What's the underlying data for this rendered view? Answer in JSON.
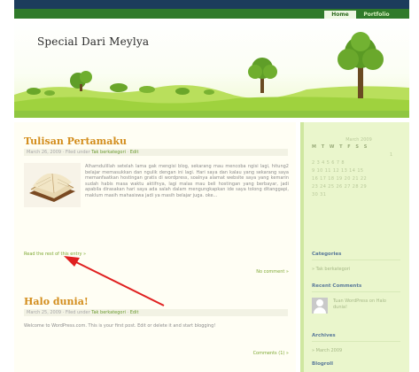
{
  "nav": {
    "items": [
      "Home",
      "Portfolio"
    ]
  },
  "header": {
    "site_title": "Special Dari Meylya"
  },
  "posts": [
    {
      "title": "Tulisan Pertamaku",
      "date": "March 26, 2009",
      "meta_label": "Filed under",
      "category": "Tak berkategori",
      "edit": "Edit",
      "body": "Alhamdulillah setelah lama gak mengisi blog, sekarang mau mencoba ngisi lagi, hitung2 belajar memasukkan dan ngulik dengan ini lagi. Hari saya dan kalau yang sekarang saya memanfaatkan hostingan gratis di wordpress, soalnya alamat website saya yang kemarin sudah habis masa waktu aktifnya, lagi malas mau beli hostingan yang berbayar, jadi apabila dirasakan hari saya ada salah dalam mengungkapkan ide saya tolong ditanggapi, maklum masih mahasiswa jadi ya masih belajar juga. oke...",
      "read_more": "Read the rest of this entry »",
      "comments": "No comment »"
    },
    {
      "title": "Halo dunia!",
      "date": "March 25, 2009",
      "meta_label": "Filed under",
      "category": "Tak berkategori",
      "edit": "Edit",
      "body": "Welcome to WordPress.com. This is your first post. Edit or delete it and start blogging!",
      "comments": "Comments (1) »"
    }
  ],
  "sidebar": {
    "calendar_title": "March 2009",
    "calendar_days": "M T W T F S S",
    "calendar_rows": [
      "1",
      "2 3 4 5 6 7 8",
      "9 10 11 12 13 14 15",
      "16 17 18 19 20 21 22",
      "23 24 25 26 27 28 29",
      "30 31"
    ],
    "categories_head": "Categories",
    "categories_item": "» Tak berkategori",
    "recent_comments_head": "Recent Comments",
    "recent_comment": "Tuan WordPress on Halo dunia!",
    "archives_head": "Archives",
    "archives_item": "» March 2009",
    "blogroll_head": "Blogroll"
  },
  "colors": {
    "accent_orange": "#d38d1c",
    "nav_green": "#2f7a2a",
    "link_green": "#7ea832",
    "annotation_arrow": "#e02020"
  },
  "icons": [
    "book-image",
    "avatar-icon",
    "tree-icon"
  ]
}
